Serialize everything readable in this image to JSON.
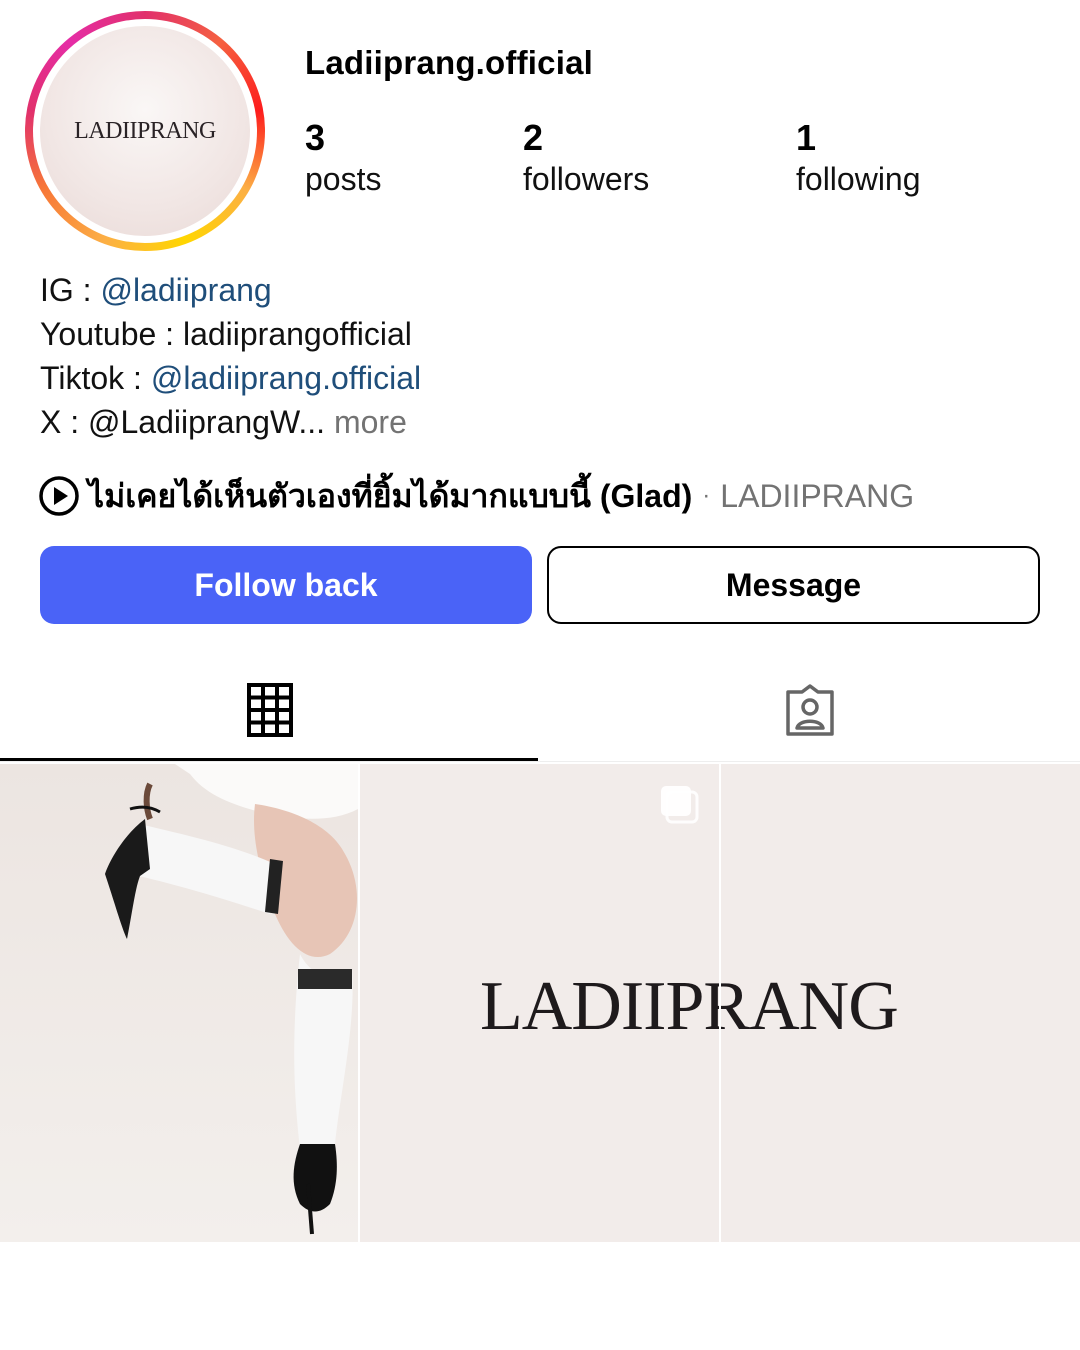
{
  "profile": {
    "username": "Ladiiprang.official",
    "avatar_text": "LADIIPRANG",
    "stats": [
      {
        "value": "3",
        "label": "posts"
      },
      {
        "value": "2",
        "label": "followers"
      },
      {
        "value": "1",
        "label": "following"
      }
    ]
  },
  "bio": {
    "ig_label": "IG : ",
    "ig_handle": "@ladiiprang",
    "youtube": "Youtube : ladiiprangofficial",
    "tiktok_label": "Tiktok : ",
    "tiktok_handle": "@ladiiprang.official",
    "x_text": "X : @LadiiprangW...",
    "more": "more"
  },
  "music": {
    "icon": "play-circle-icon",
    "song": "ไม่เคยได้เห็นตัวเองที่ยิ้มได้มากแบบนี้ (Glad)",
    "separator": "·",
    "artist": "LADIIPRANG"
  },
  "buttons": {
    "follow_back": "Follow back",
    "message": "Message"
  },
  "tabs": [
    {
      "name": "grid",
      "icon": "grid-icon",
      "active": true
    },
    {
      "name": "tagged",
      "icon": "tagged-person-icon",
      "active": false
    }
  ],
  "posts": {
    "logo_text": "LADIIPRANG",
    "multi_post_icon": "carousel-icon"
  },
  "colors": {
    "follow_button": "#4a63f7",
    "link": "#1f4e7a",
    "secondary_text": "#737373"
  }
}
